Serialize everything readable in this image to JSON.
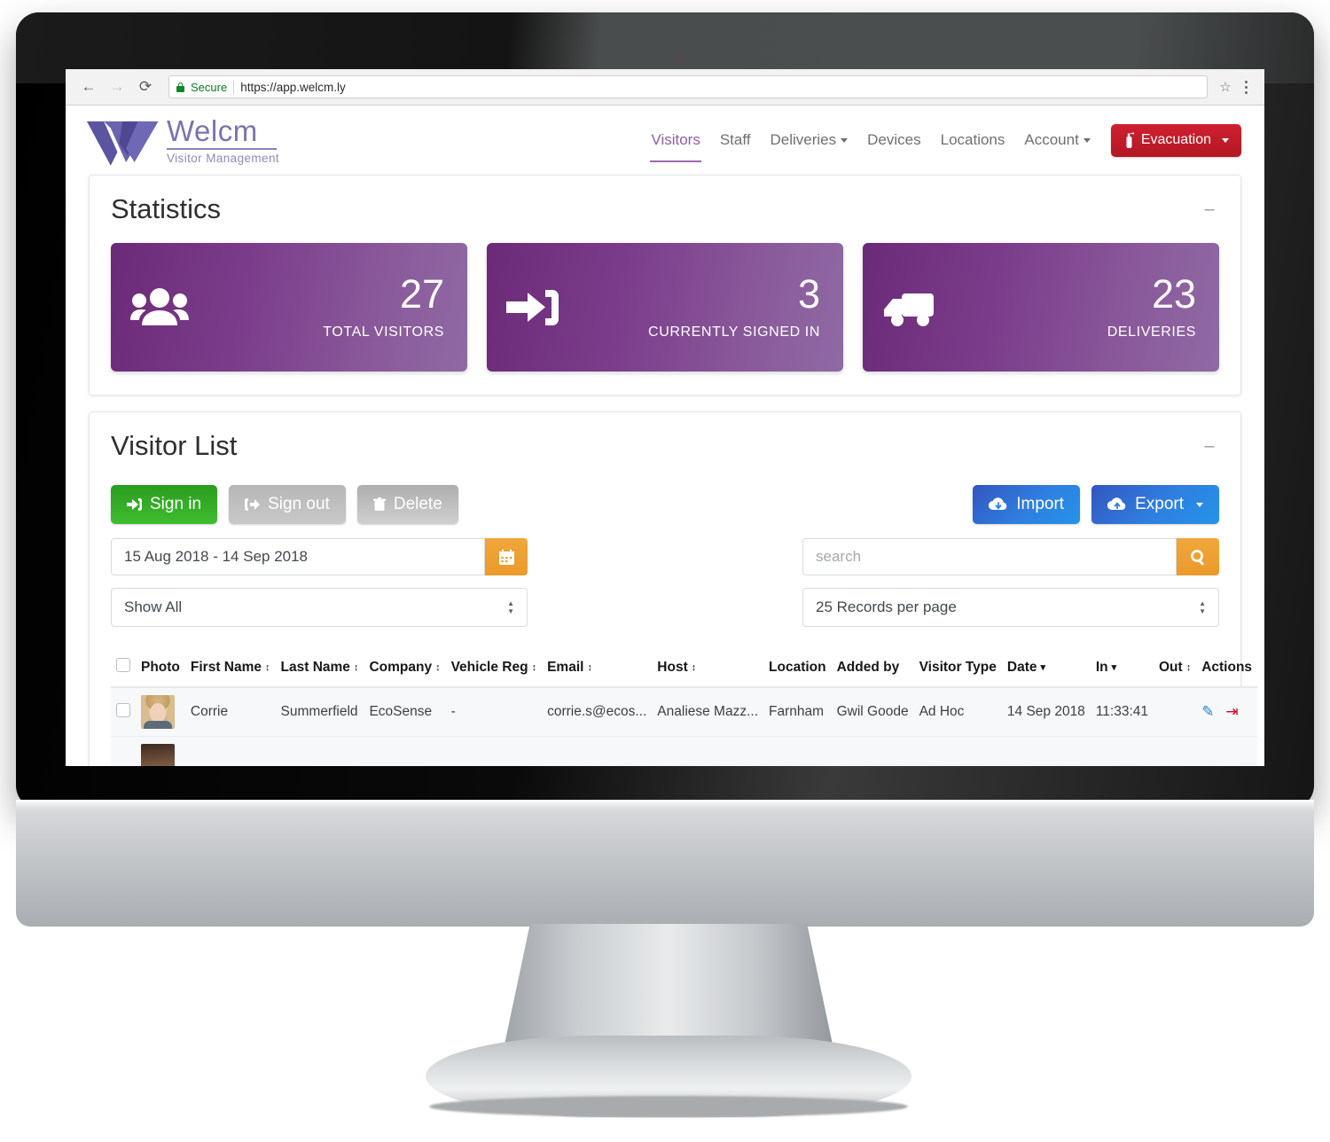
{
  "browser": {
    "back_icon": "arrow-left-icon",
    "forward_icon": "arrow-right-icon",
    "reload_icon": "reload-icon",
    "secure_label": "Secure",
    "url": "https://app.welcm.ly",
    "bookmark_icon": "star-icon",
    "menu_icon": "kebab-menu-icon"
  },
  "brand": {
    "name": "Welcm",
    "tagline": "Visitor Management",
    "logo_icon": "welcm-w-logo",
    "color": "#7b74ad"
  },
  "nav": {
    "items": [
      {
        "label": "Visitors",
        "active": true,
        "dropdown": false
      },
      {
        "label": "Staff",
        "active": false,
        "dropdown": false
      },
      {
        "label": "Deliveries",
        "active": false,
        "dropdown": true
      },
      {
        "label": "Devices",
        "active": false,
        "dropdown": false
      },
      {
        "label": "Locations",
        "active": false,
        "dropdown": false
      },
      {
        "label": "Account",
        "active": false,
        "dropdown": true
      }
    ],
    "evacuation": {
      "label": "Evacuation",
      "icon": "fire-extinguisher-icon",
      "color": "#c31f2c",
      "dropdown": true
    }
  },
  "statistics": {
    "title": "Statistics",
    "collapse_icon": "minus-icon",
    "cards": [
      {
        "value": "27",
        "label": "TOTAL VISITORS",
        "icon": "users-group-icon"
      },
      {
        "value": "3",
        "label": "CURRENTLY SIGNED IN",
        "icon": "sign-in-arrow-icon"
      },
      {
        "value": "23",
        "label": "DELIVERIES",
        "icon": "truck-icon"
      }
    ],
    "card_gradient_from": "#6b2a78",
    "card_gradient_to": "#8f6aa3"
  },
  "visitor_list": {
    "title": "Visitor List",
    "collapse_icon": "minus-icon",
    "actions": {
      "sign_in": {
        "label": "Sign in",
        "icon": "sign-in-icon",
        "color": "#34ab27",
        "enabled": true
      },
      "sign_out": {
        "label": "Sign out",
        "icon": "sign-out-icon",
        "color": "#c0c0c0",
        "enabled": false
      },
      "delete": {
        "label": "Delete",
        "icon": "trash-icon",
        "color": "#c0c0c0",
        "enabled": false
      },
      "import": {
        "label": "Import",
        "icon": "cloud-download-icon",
        "color": "#2d75d8"
      },
      "export": {
        "label": "Export",
        "icon": "cloud-upload-icon",
        "color": "#2d75d8",
        "dropdown": true
      }
    },
    "filters": {
      "date_range_value": "15 Aug 2018 - 14 Sep 2018",
      "calendar_icon": "calendar-icon",
      "show_select_value": "Show All",
      "search_placeholder": "search",
      "search_value": "",
      "search_icon": "search-icon",
      "records_select_value": "25 Records per page"
    },
    "table": {
      "columns": [
        {
          "label": "",
          "sort": "none",
          "key": "check"
        },
        {
          "label": "Photo",
          "sort": "none"
        },
        {
          "label": "First Name",
          "sort": "both"
        },
        {
          "label": "Last Name",
          "sort": "both"
        },
        {
          "label": "Company",
          "sort": "both"
        },
        {
          "label": "Vehicle Reg",
          "sort": "both"
        },
        {
          "label": "Email",
          "sort": "both"
        },
        {
          "label": "Host",
          "sort": "both"
        },
        {
          "label": "Location",
          "sort": "none"
        },
        {
          "label": "Added by",
          "sort": "none"
        },
        {
          "label": "Visitor Type",
          "sort": "none"
        },
        {
          "label": "Date",
          "sort": "desc"
        },
        {
          "label": "In",
          "sort": "desc"
        },
        {
          "label": "Out",
          "sort": "both"
        },
        {
          "label": "Actions",
          "sort": "none"
        }
      ],
      "rows": [
        {
          "photo": "visitor-photo",
          "first_name": "Corrie",
          "last_name": "Summerfield",
          "company": "EcoSense",
          "vehicle_reg": "-",
          "email": "corrie.s@ecos...",
          "host": "Analiese Mazz...",
          "location": "Farnham",
          "added_by": "Gwil Goode",
          "visitor_type": "Ad Hoc",
          "date": "14 Sep 2018",
          "in": "11:33:41",
          "out": "",
          "actions": [
            "edit-icon",
            "sign-out-icon"
          ]
        }
      ]
    }
  }
}
